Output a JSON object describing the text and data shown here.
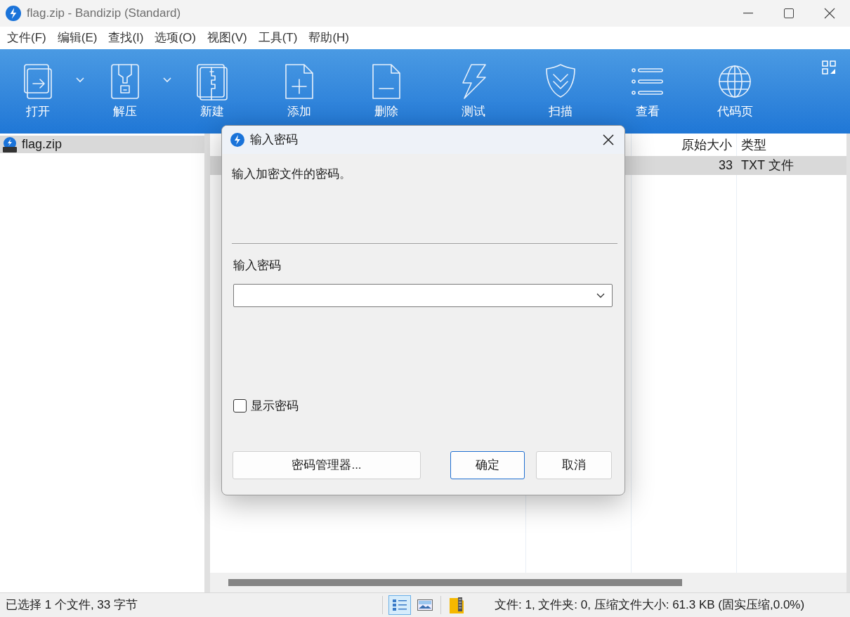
{
  "window": {
    "title": "flag.zip - Bandizip (Standard)"
  },
  "menu": [
    "文件(F)",
    "编辑(E)",
    "查找(I)",
    "选项(O)",
    "视图(V)",
    "工具(T)",
    "帮助(H)"
  ],
  "toolbar": [
    {
      "label": "打开",
      "kind": "open",
      "has_menu": true
    },
    {
      "label": "解压",
      "kind": "extract",
      "has_menu": true
    },
    {
      "label": "新建",
      "kind": "new",
      "has_menu": false
    },
    {
      "label": "添加",
      "kind": "add",
      "has_menu": false
    },
    {
      "label": "删除",
      "kind": "delete",
      "has_menu": false
    },
    {
      "label": "测试",
      "kind": "test",
      "has_menu": false
    },
    {
      "label": "扫描",
      "kind": "scan",
      "has_menu": false
    },
    {
      "label": "查看",
      "kind": "view",
      "has_menu": false
    },
    {
      "label": "代码页",
      "kind": "codepage",
      "has_menu": false
    }
  ],
  "tree": [
    {
      "label": "flag.zip",
      "selected": true
    }
  ],
  "table": {
    "columns": [
      "原始大小",
      "类型"
    ],
    "rows": [
      {
        "cells": [
          "33",
          "TXT 文件"
        ],
        "selected": true
      }
    ]
  },
  "dialog": {
    "title": "输入密码",
    "message": "输入加密文件的密码。",
    "field_label": "输入密码",
    "show_password": {
      "label": "显示密码",
      "checked": false
    },
    "buttons": [
      {
        "label": "密码管理器...",
        "default": false
      },
      {
        "label": "确定",
        "default": true
      },
      {
        "label": "取消",
        "default": false
      }
    ]
  },
  "status_bar": {
    "left": "已选择 1 个文件, 33 字节",
    "right": "文件: 1, 文件夹: 0, 压缩文件大小: 61.3 KB (固实压缩,0.0%)"
  }
}
